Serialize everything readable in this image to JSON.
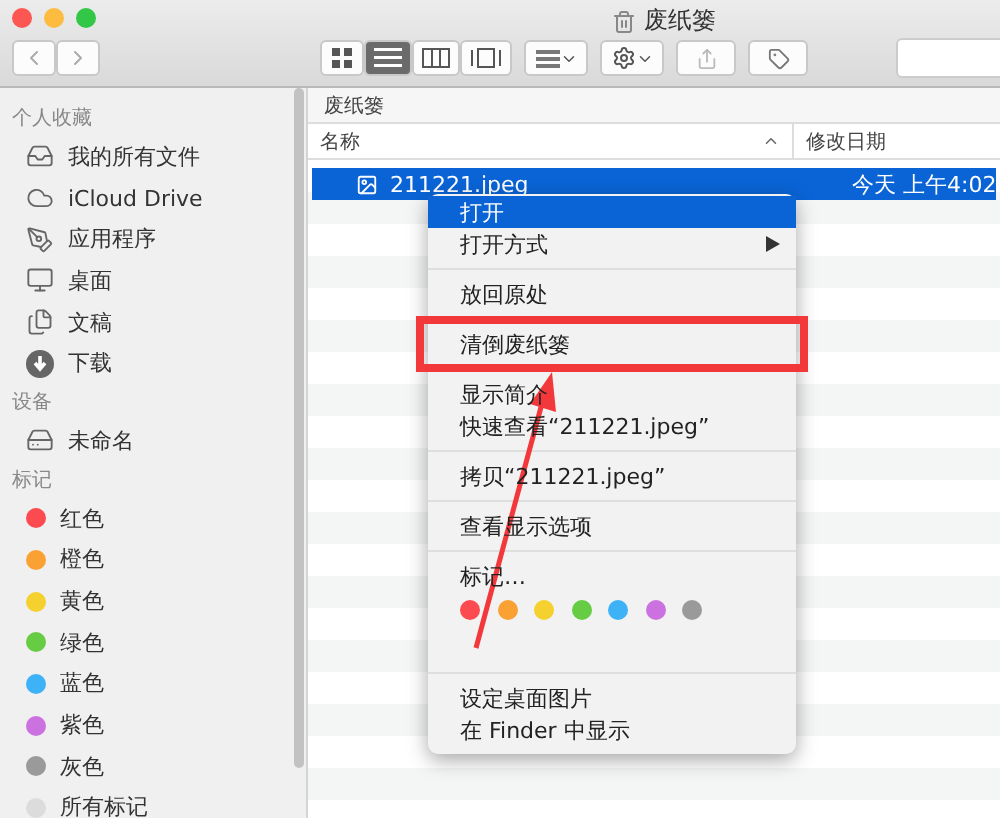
{
  "window": {
    "title": "废纸篓"
  },
  "toolbar": {
    "view_buttons": [
      {
        "kind": "icons",
        "selected": false
      },
      {
        "kind": "list",
        "selected": true
      },
      {
        "kind": "columns",
        "selected": false
      },
      {
        "kind": "coverflow",
        "selected": false
      }
    ]
  },
  "sidebar": {
    "sections": [
      {
        "heading": "个人收藏",
        "items": [
          {
            "label": "我的所有文件",
            "kind": "files"
          },
          {
            "label": "iCloud Drive",
            "kind": "cloud"
          },
          {
            "label": "应用程序",
            "kind": "apps"
          },
          {
            "label": "桌面",
            "kind": "desktop"
          },
          {
            "label": "文稿",
            "kind": "docs"
          },
          {
            "label": "下载",
            "kind": "download"
          }
        ]
      },
      {
        "heading": "设备",
        "items": [
          {
            "label": "未命名",
            "kind": "disk"
          }
        ]
      },
      {
        "heading": "标记",
        "items": [
          {
            "label": "红色",
            "kind": "tag",
            "color": "#fc4b50"
          },
          {
            "label": "橙色",
            "kind": "tag",
            "color": "#f9a133"
          },
          {
            "label": "黄色",
            "kind": "tag",
            "color": "#f5d12f"
          },
          {
            "label": "绿色",
            "kind": "tag",
            "color": "#66cc44"
          },
          {
            "label": "蓝色",
            "kind": "tag",
            "color": "#3eb2f7"
          },
          {
            "label": "紫色",
            "kind": "tag",
            "color": "#cc72e0"
          },
          {
            "label": "灰色",
            "kind": "tag",
            "color": "#9a9a9a"
          },
          {
            "label": "所有标记",
            "kind": "alltags"
          }
        ]
      }
    ]
  },
  "path_bar": "废纸篓",
  "table": {
    "columns": [
      "名称",
      "修改日期"
    ],
    "rows": [
      {
        "name": "211221.jpeg",
        "modified": "今天 上午4:02",
        "selected": true
      }
    ]
  },
  "context_menu": {
    "groups": [
      [
        {
          "label": "打开",
          "selected": true
        },
        {
          "label": "打开方式",
          "selected": false,
          "submenu": true
        }
      ],
      [
        {
          "label": "放回原处",
          "selected": false
        }
      ],
      [
        {
          "label": "清倒废纸篓",
          "selected": false,
          "marked": true
        }
      ],
      [
        {
          "label": "显示简介",
          "selected": false
        },
        {
          "label": "快速查看“211221.jpeg”",
          "selected": false
        }
      ],
      [
        {
          "label": "拷贝“211221.jpeg”",
          "selected": false
        }
      ],
      [
        {
          "label": "查看显示选项",
          "selected": false
        }
      ],
      [
        {
          "label": "标记…",
          "selected": false
        }
      ],
      [
        {
          "label": "设定桌面图片",
          "selected": false
        },
        {
          "label": "在 Finder 中显示",
          "selected": false
        }
      ]
    ],
    "tag_colors": [
      {
        "color": "#fc4b50"
      },
      {
        "color": "#f9a133"
      },
      {
        "color": "#f5d12f"
      },
      {
        "color": "#66cc44"
      },
      {
        "color": "#3eb2f7"
      },
      {
        "color": "#cc72e0"
      },
      {
        "color": "#9a9a9a"
      }
    ]
  }
}
